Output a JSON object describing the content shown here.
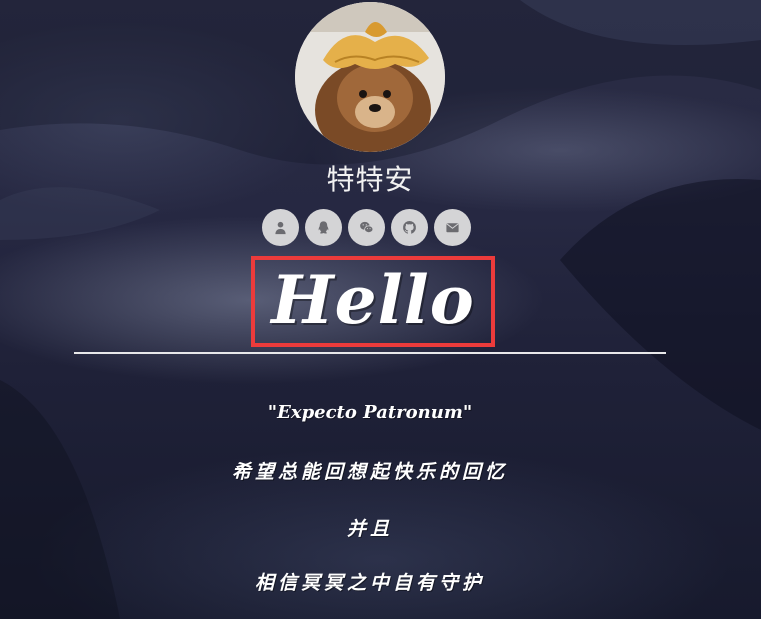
{
  "profile": {
    "name": "特特安"
  },
  "socials": [
    {
      "icon": "user-icon"
    },
    {
      "icon": "qq-icon"
    },
    {
      "icon": "wechat-icon"
    },
    {
      "icon": "github-icon"
    },
    {
      "icon": "mail-icon"
    }
  ],
  "hero": {
    "greeting": "Hello",
    "highlight_color": "#ec3b3b"
  },
  "quote": {
    "line1": "\"Expecto Patronum\"",
    "line2": "希望总能回想起快乐的回忆",
    "line3": "并且",
    "line4": "相信冥冥之中自有守护"
  }
}
